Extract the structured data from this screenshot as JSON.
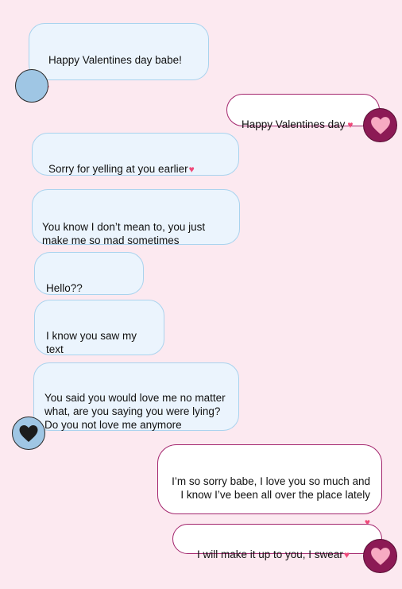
{
  "messages": [
    {
      "side": "left",
      "text": "Happy Valentines day babe!",
      "emoji": "♥"
    },
    {
      "side": "right",
      "text": "Happy Valentines day",
      "emoji": "♥"
    },
    {
      "side": "left",
      "text": "Sorry for yelling at you earlier",
      "emoji": "♥"
    },
    {
      "side": "left",
      "text": "You know I don’t mean to, you just\nmake me so mad sometimes",
      "emoji": ""
    },
    {
      "side": "left",
      "text": "Hello??",
      "emoji": ""
    },
    {
      "side": "left",
      "text": "I know you saw my\ntext",
      "emoji": ""
    },
    {
      "side": "left",
      "text": "You said you would love me no matter\nwhat, are you saying you were lying?\nDo you not love me anymore",
      "emoji": ""
    },
    {
      "side": "right",
      "text": "I’m so sorry babe, I love you so much and\nI know I’ve been all over the place lately",
      "emoji": "♥"
    },
    {
      "side": "right",
      "text": "I will make it up to you, I swear",
      "emoji": "♥"
    }
  ],
  "avatars": {
    "left_icon": "blue-circle-avatar",
    "right_icon": "pink-heart-avatar",
    "left_heart_icon": "black-heart-avatar"
  },
  "colors": {
    "background": "#fce9f0",
    "left_bubble": "#ebf4fd",
    "left_border": "#a9d3ee",
    "right_border": "#a3256d",
    "right_avatar": "#8c1a55",
    "heart": "#ef4a7a"
  }
}
